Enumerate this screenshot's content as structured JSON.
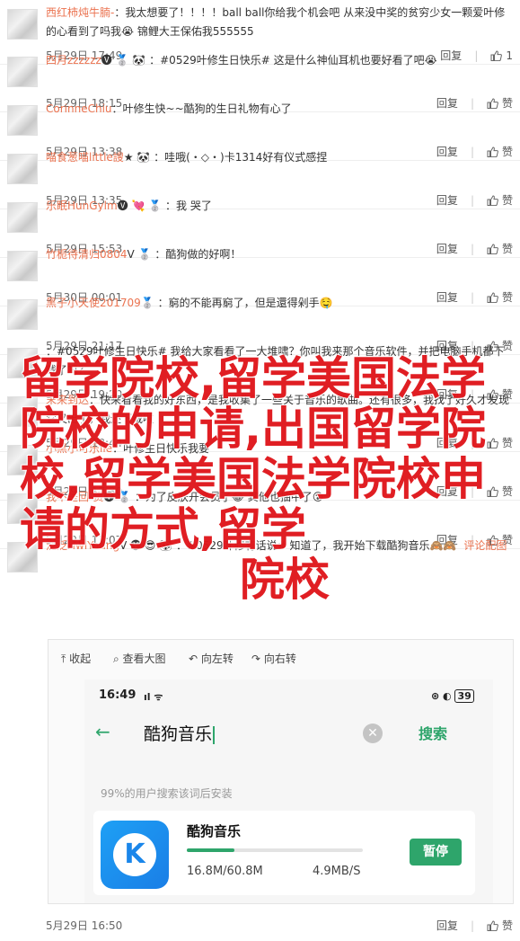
{
  "comments": [
    {
      "user": "西红柿炖牛腩-",
      "text": "：我太想要了！！！！ball  ball你给我个机会吧 从来没中奖的贫穷少女一颗爱叶修的心看到了吗我😭 锦鲤大王保佑我555555",
      "time": "5月29日 17:49",
      "reply": "回复",
      "likes": "1"
    },
    {
      "user": "四月zzzzzz",
      "text": "🅥 🥈 🐼 ：#0529叶修生日快乐# 这是什么神仙耳机也要好看了吧😭",
      "time": "5月29日 18:15",
      "reply": "回复",
      "likes": "赞"
    },
    {
      "user": "CorinneChiu",
      "text": "：叶修生快~~酷狗的生日礼物有心了",
      "time": "5月29日 13:38",
      "reply": "回复",
      "likes": "赞"
    },
    {
      "user": "喵食葱喵little謏",
      "text": "★ 🐼 ：哇哦(・◇・)卡1314好有仪式感捏",
      "time": "5月29日 13:35",
      "reply": "回复",
      "likes": "赞"
    },
    {
      "user": "乐眠HunGylm",
      "text": "🅥 💘 🥈 ：我   哭了",
      "time": "5月29日 15:53",
      "reply": "回复",
      "likes": "赞"
    },
    {
      "user": "竹栀待清归0804",
      "text": "Ⅴ 🥈 ：酷狗做的好啊！",
      "time": "5月30日 00:01",
      "reply": "回复",
      "likes": "赞"
    },
    {
      "user": "黑子小天使201709",
      "text": "🥈 ：窮的不能再窮了，但是還得剁手🤤",
      "time": "5月29日 21:17",
      "reply": "回复",
      "likes": "赞"
    },
    {
      "user": "",
      "text": "：#0529叶修生日快乐# 我给大家看看了一大堆啸？你叫我来那个音乐软件，并把电脑手机都下载了吗？",
      "time": "5月29日 19:20",
      "reply": "回复",
      "likes": "赞"
    },
    {
      "user": "末来到达",
      "text": "：快来看看我的好东西，是我收集了一些关于音乐的歌曲。还有很多，我找了好久才发现它又出了，我还下载啦",
      "time": "5月29日 18:44",
      "reply": "回复",
      "likes": "赞"
    },
    {
      "user": "小黑小可乐ile",
      "text": "：叶修生日快乐我要",
      "time": "5月29日 17:30",
      "reply": "回复",
      "likes": "赞"
    },
    {
      "user": "我不是回-货",
      "text": "🅥 🥈 ：为了皮肤开会员了😂 其他也抽中了😮",
      "time": "5月29日 17:07",
      "reply": "回复",
      "likes": "赞"
    },
    {
      "user": "泛泛HwiYoung",
      "text": "Ⅴ 🅥 😎 🐼 ：#0529叶修有话说# 知道了，我开始下载酷狗音乐🙈🙈",
      "time": "5月29日 16:50",
      "reply": "回复",
      "likes": "赞",
      "extra": "评论配图"
    }
  ],
  "embedded": {
    "toolbar": {
      "collapse": "收起",
      "view_large": "查看大图",
      "rotate_left": "向左转",
      "rotate_right": "向右转"
    },
    "status": {
      "time": "16:49",
      "battery": "39"
    },
    "search": {
      "query": "酷狗音乐",
      "button": "搜索"
    },
    "hint": "99%的用户搜索该词后安装",
    "app": {
      "name": "酷狗音乐",
      "icon_letter": "K",
      "progress": 0.27,
      "size": "16.8M/60.8M",
      "speed": "4.9MB/S",
      "pause": "暂停"
    }
  },
  "watermark": {
    "lines": "留学院校,留学美国法学院校的申请,出国留学院校,留学美国法学院校申请的方式,留学",
    "tail": "院校"
  },
  "colors": {
    "username": "#eb7350",
    "accent": "#2ea56b",
    "watermark": "#e0171c"
  }
}
